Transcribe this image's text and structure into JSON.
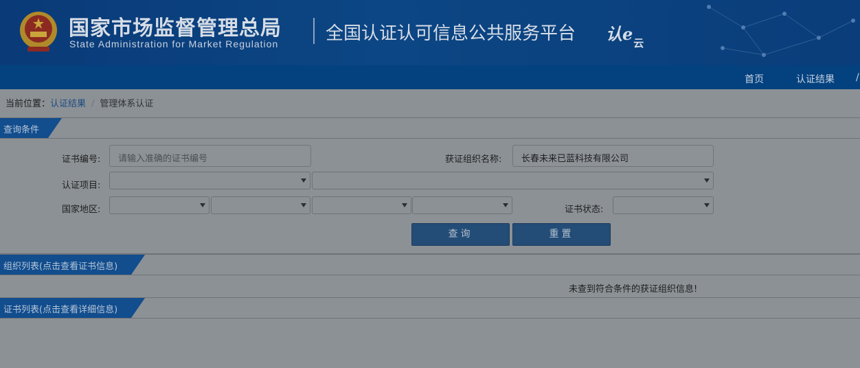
{
  "header": {
    "agency_name_cn": "国家市场监督管理总局",
    "agency_name_en": "State Administration  for  Market Regulation",
    "platform_title": "全国认证认可信息公共服务平台",
    "logo_text_main": "认e",
    "logo_text_sub": "云"
  },
  "nav": {
    "items": [
      {
        "label": "首页"
      },
      {
        "label": "认证结果"
      },
      {
        "label": "/"
      }
    ]
  },
  "breadcrumb": {
    "prefix": "当前位置：",
    "link": "认证结果",
    "separator": "/",
    "current": "管理体系认证"
  },
  "query": {
    "section_title": "查询条件",
    "cert_no": {
      "label": "证书编号:",
      "value": "",
      "placeholder": "请输入准确的证书编号"
    },
    "org_name": {
      "label": "获证组织名称:",
      "value": "长春未来已蓝科技有限公司"
    },
    "cert_project": {
      "label": "认证项目:",
      "value_1": "",
      "value_2": ""
    },
    "region": {
      "label": "国家地区:",
      "values": [
        "",
        "",
        "",
        ""
      ]
    },
    "cert_status": {
      "label": "证书状态:",
      "value": ""
    },
    "search_label": "查询",
    "reset_label": "重置"
  },
  "org_list": {
    "section_title": "组织列表(点击查看证书信息)",
    "empty_message": "未查到符合条件的获证组织信息!"
  },
  "cert_list": {
    "section_title": "证书列表(点击查看详细信息)"
  },
  "colors": {
    "header_blue": "#0c4684",
    "nav_blue": "#04417f",
    "section_tab_blue": "#124d8d",
    "button_blue": "#234c76",
    "overlay_gray": "#8c9195"
  }
}
